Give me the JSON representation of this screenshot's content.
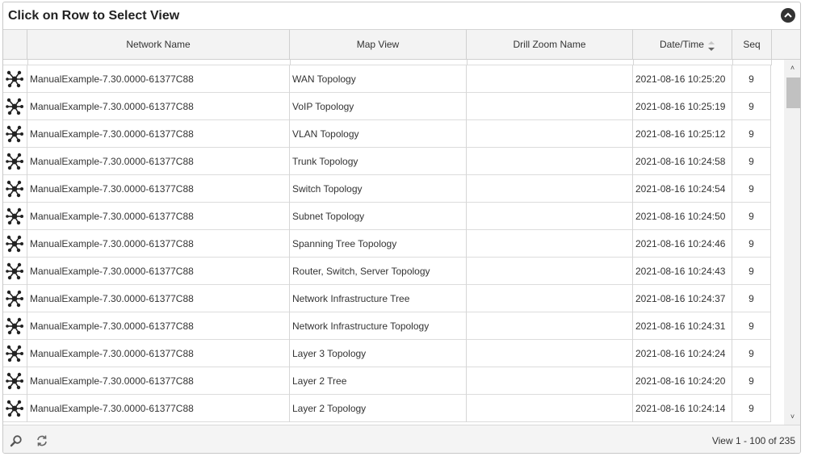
{
  "panel": {
    "title": "Click on Row to Select View"
  },
  "columns": [
    {
      "label": ""
    },
    {
      "label": "Network Name"
    },
    {
      "label": "Map View"
    },
    {
      "label": "Drill Zoom Name"
    },
    {
      "label": "Date/Time"
    },
    {
      "label": "Seq"
    }
  ],
  "sort": {
    "column": "Date/Time",
    "direction": "descending"
  },
  "rows": [
    {
      "icon": "network-topology-icon",
      "network": "ManualExample-7.30.0000-61377C88",
      "map_view": "WAN Topology",
      "drill": "",
      "datetime": "2021-08-16 10:25:20",
      "seq": "9"
    },
    {
      "icon": "network-topology-icon",
      "network": "ManualExample-7.30.0000-61377C88",
      "map_view": "VoIP Topology",
      "drill": "",
      "datetime": "2021-08-16 10:25:19",
      "seq": "9"
    },
    {
      "icon": "network-topology-icon",
      "network": "ManualExample-7.30.0000-61377C88",
      "map_view": "VLAN Topology",
      "drill": "",
      "datetime": "2021-08-16 10:25:12",
      "seq": "9"
    },
    {
      "icon": "network-topology-icon",
      "network": "ManualExample-7.30.0000-61377C88",
      "map_view": "Trunk Topology",
      "drill": "",
      "datetime": "2021-08-16 10:24:58",
      "seq": "9"
    },
    {
      "icon": "network-topology-icon",
      "network": "ManualExample-7.30.0000-61377C88",
      "map_view": "Switch Topology",
      "drill": "",
      "datetime": "2021-08-16 10:24:54",
      "seq": "9"
    },
    {
      "icon": "network-topology-icon",
      "network": "ManualExample-7.30.0000-61377C88",
      "map_view": "Subnet Topology",
      "drill": "",
      "datetime": "2021-08-16 10:24:50",
      "seq": "9"
    },
    {
      "icon": "network-topology-icon",
      "network": "ManualExample-7.30.0000-61377C88",
      "map_view": "Spanning Tree Topology",
      "drill": "",
      "datetime": "2021-08-16 10:24:46",
      "seq": "9"
    },
    {
      "icon": "network-topology-icon",
      "network": "ManualExample-7.30.0000-61377C88",
      "map_view": "Router, Switch, Server Topology",
      "drill": "",
      "datetime": "2021-08-16 10:24:43",
      "seq": "9"
    },
    {
      "icon": "network-topology-icon",
      "network": "ManualExample-7.30.0000-61377C88",
      "map_view": "Network Infrastructure Tree",
      "drill": "",
      "datetime": "2021-08-16 10:24:37",
      "seq": "9"
    },
    {
      "icon": "network-topology-icon",
      "network": "ManualExample-7.30.0000-61377C88",
      "map_view": "Network Infrastructure Topology",
      "drill": "",
      "datetime": "2021-08-16 10:24:31",
      "seq": "9"
    },
    {
      "icon": "network-topology-icon",
      "network": "ManualExample-7.30.0000-61377C88",
      "map_view": "Layer 3 Topology",
      "drill": "",
      "datetime": "2021-08-16 10:24:24",
      "seq": "9"
    },
    {
      "icon": "network-topology-icon",
      "network": "ManualExample-7.30.0000-61377C88",
      "map_view": "Layer 2 Tree",
      "drill": "",
      "datetime": "2021-08-16 10:24:20",
      "seq": "9"
    },
    {
      "icon": "network-topology-icon",
      "network": "ManualExample-7.30.0000-61377C88",
      "map_view": "Layer 2 Topology",
      "drill": "",
      "datetime": "2021-08-16 10:24:14",
      "seq": "9"
    }
  ],
  "footer": {
    "search_icon": "search-icon",
    "refresh_icon": "refresh-icon",
    "pager_text": "View 1 - 100 of 235"
  },
  "icons": {
    "collapse": "collapse-up-icon",
    "scroll_up": "chevron-up-icon",
    "scroll_down": "chevron-down-icon"
  },
  "colors": {
    "header_bg": "#f3f3f3",
    "footer_bg": "#f4f4f4",
    "icon": "#222222"
  }
}
